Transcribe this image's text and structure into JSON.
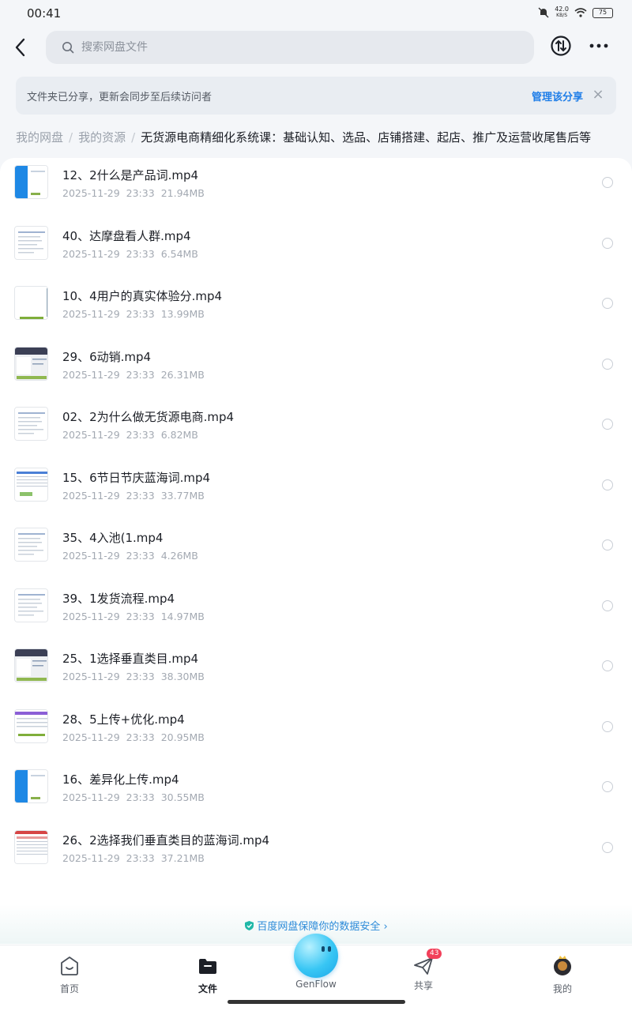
{
  "status_bar": {
    "time": "00:41",
    "net_speed": "42.0",
    "net_unit": "KB/S",
    "battery": "75"
  },
  "search": {
    "placeholder": "搜索网盘文件"
  },
  "share_banner": {
    "text": "文件夹已分享，更新会同步至后续访问者",
    "action": "管理该分享",
    "close": "×"
  },
  "breadcrumb": {
    "items": [
      "我的网盘",
      "我的资源"
    ],
    "separator": "/",
    "current": "无货源电商精细化系统课：基础认知、选品、店铺搭建、起店、推广及运营收尾售后等"
  },
  "files": [
    {
      "name": "12、2什么是产品词.mp4",
      "date": "2025-11-29",
      "time": "23:33",
      "size": "21.94MB",
      "thumb": "blue"
    },
    {
      "name": "40、达摩盘看人群.mp4",
      "date": "2025-11-29",
      "time": "23:33",
      "size": "6.54MB",
      "thumb": "doc"
    },
    {
      "name": "10、4用户的真实体验分.mp4",
      "date": "2025-11-29",
      "time": "23:33",
      "size": "13.99MB",
      "thumb": "plain"
    },
    {
      "name": "29、6动销.mp4",
      "date": "2025-11-29",
      "time": "23:33",
      "size": "26.31MB",
      "thumb": "dark"
    },
    {
      "name": "02、2为什么做无货源电商.mp4",
      "date": "2025-11-29",
      "time": "23:33",
      "size": "6.82MB",
      "thumb": "doc"
    },
    {
      "name": "15、6节日节庆蓝海词.mp4",
      "date": "2025-11-29",
      "time": "23:33",
      "size": "33.77MB",
      "thumb": "table"
    },
    {
      "name": "35、4入池(1.mp4",
      "date": "2025-11-29",
      "time": "23:33",
      "size": "4.26MB",
      "thumb": "doc"
    },
    {
      "name": "39、1发货流程.mp4",
      "date": "2025-11-29",
      "time": "23:33",
      "size": "14.97MB",
      "thumb": "doc"
    },
    {
      "name": "25、1选择垂直类目.mp4",
      "date": "2025-11-29",
      "time": "23:33",
      "size": "38.30MB",
      "thumb": "dark"
    },
    {
      "name": "28、5上传+优化.mp4",
      "date": "2025-11-29",
      "time": "23:33",
      "size": "20.95MB",
      "thumb": "purple"
    },
    {
      "name": "16、差异化上传.mp4",
      "date": "2025-11-29",
      "time": "23:33",
      "size": "30.55MB",
      "thumb": "blue"
    },
    {
      "name": "26、2选择我们垂直类目的蓝海词.mp4",
      "date": "2025-11-29",
      "time": "23:33",
      "size": "37.21MB",
      "thumb": "red"
    }
  ],
  "safety": {
    "text": "百度网盘保障你的数据安全"
  },
  "nav": {
    "home": "首页",
    "files": "文件",
    "genflow": "GenFlow",
    "share": "共享",
    "share_badge": "43",
    "mine": "我的"
  },
  "colors": {
    "accent": "#1f7ee8",
    "badge": "#f2405a",
    "genflow": "#38c6f4"
  }
}
